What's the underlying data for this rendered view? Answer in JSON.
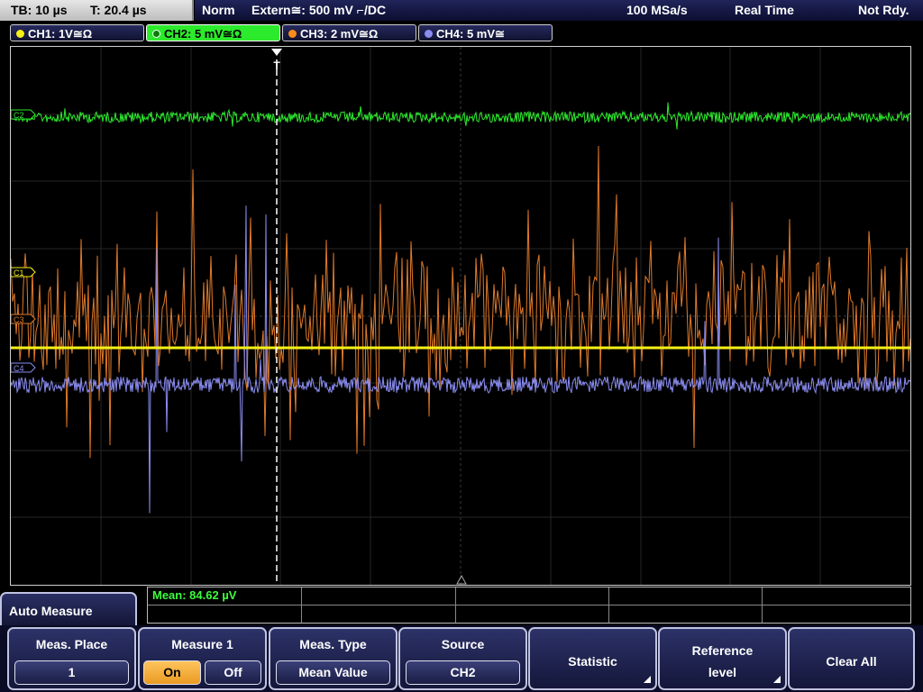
{
  "status": {
    "timebase": "TB: 10 µs",
    "trigger_time": "T: 20.4 µs",
    "mode": "Norm",
    "trigger_source": "Extern≅: 500 mV ⌐/DC",
    "sample_rate": "100 MSa/s",
    "acq_mode": "Real Time",
    "state": "Not Rdy."
  },
  "channels": [
    {
      "label": "CH1: 1V≅Ω",
      "color": "#f5f016"
    },
    {
      "label": "CH2: 5 mV≅Ω",
      "color": "#2cea2c"
    },
    {
      "label": "CH3: 2 mV≅Ω",
      "color": "#ff8c1a"
    },
    {
      "label": "CH4: 5 mV≅",
      "color": "#8a8cf0"
    }
  ],
  "markers": {
    "c2": "C2",
    "c1": "C1",
    "c3": "C3",
    "c4": "C4",
    "trigger": "T"
  },
  "colors": {
    "ch1": "#f5f016",
    "ch2": "#2cea2c",
    "ch3": "#e07a2a",
    "ch4": "#8a8cf0",
    "accent_on": "#f0aa35"
  },
  "measurement": {
    "result": "Mean: 84.62 µV"
  },
  "menu": {
    "title": "Auto Measure",
    "meas_place": {
      "label": "Meas. Place",
      "value": "1"
    },
    "measure": {
      "label": "Measure 1",
      "on": "On",
      "off": "Off"
    },
    "meas_type": {
      "label": "Meas. Type",
      "value": "Mean Value"
    },
    "source": {
      "label": "Source",
      "value": "CH2"
    },
    "statistic": {
      "label": "Statistic"
    },
    "reference_level": {
      "label_line1": "Reference",
      "label_line2": "level"
    },
    "clear_all": {
      "label": "Clear All"
    }
  }
}
